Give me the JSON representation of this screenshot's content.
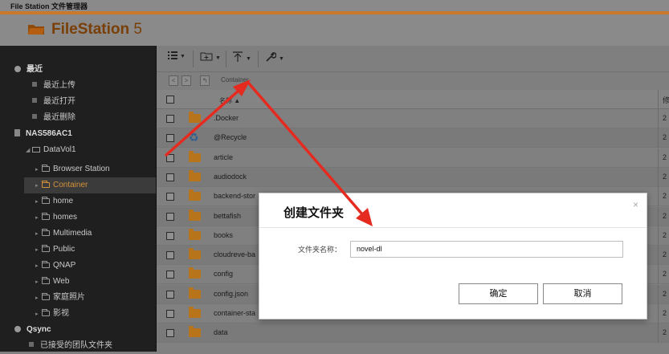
{
  "window": {
    "title": "File Station 文件管理器"
  },
  "app": {
    "name": "FileStation",
    "version": " 5"
  },
  "colors": {
    "accent": "#c8792a",
    "annotation": "#e52a1f"
  },
  "sidebar": {
    "recent": {
      "label": "最近",
      "items": [
        "最近上传",
        "最近打开",
        "最近删除"
      ]
    },
    "nas": {
      "label": "NAS586AC1"
    },
    "volume": {
      "label": "DataVol1"
    },
    "folders": [
      "Browser Station",
      "Container",
      "home",
      "homes",
      "Multimedia",
      "Public",
      "QNAP",
      "Web",
      "家庭照片",
      "影视"
    ],
    "active_folder": "Container",
    "qsync": {
      "label": "Qsync",
      "items": [
        "已接受的团队文件夹"
      ]
    }
  },
  "toolbar": {
    "icons": [
      "list-view-icon",
      "new-folder-icon",
      "upload-icon",
      "tools-icon"
    ]
  },
  "pathbar": {
    "crumb": "Container"
  },
  "file_list": {
    "column_name": "名称 ▲",
    "right_col_header": "修",
    "rows": [
      {
        "name": ".Docker",
        "icon": "folder",
        "right": "2"
      },
      {
        "name": "@Recycle",
        "icon": "recycle",
        "right": "2"
      },
      {
        "name": "article",
        "icon": "folder",
        "right": "2"
      },
      {
        "name": "audiodock",
        "icon": "folder",
        "right": "2"
      },
      {
        "name": "backend-stor",
        "icon": "folder",
        "right": "2"
      },
      {
        "name": "bettafish",
        "icon": "folder",
        "right": "2"
      },
      {
        "name": "books",
        "icon": "folder",
        "right": "2"
      },
      {
        "name": "cloudreve-ba",
        "icon": "folder",
        "right": "2"
      },
      {
        "name": "config",
        "icon": "folder",
        "right": "2"
      },
      {
        "name": "config.json",
        "icon": "folder",
        "right": "2"
      },
      {
        "name": "container-sta",
        "icon": "folder",
        "right": "2"
      },
      {
        "name": "data",
        "icon": "folder",
        "right": "2"
      }
    ]
  },
  "dialog": {
    "title": "创建文件夹",
    "close": "×",
    "field_label": "文件夹名称：",
    "field_value": "novel-dl",
    "ok": "确定",
    "cancel": "取消"
  }
}
